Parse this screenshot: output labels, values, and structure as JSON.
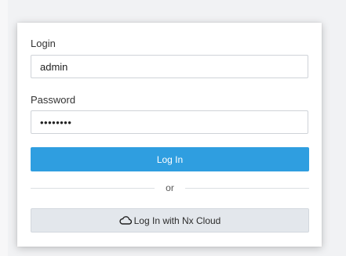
{
  "login_form": {
    "login_label": "Login",
    "login_value": "admin",
    "password_label": "Password",
    "password_value": "password",
    "login_button": "Log In",
    "divider_text": "or",
    "cloud_button": "Log In with Nx Cloud",
    "cloud_icon": "cloud-icon"
  },
  "colors": {
    "primary": "#2f9ee0",
    "secondary_button": "#e3e7ec",
    "background": "#f1f2f4"
  }
}
